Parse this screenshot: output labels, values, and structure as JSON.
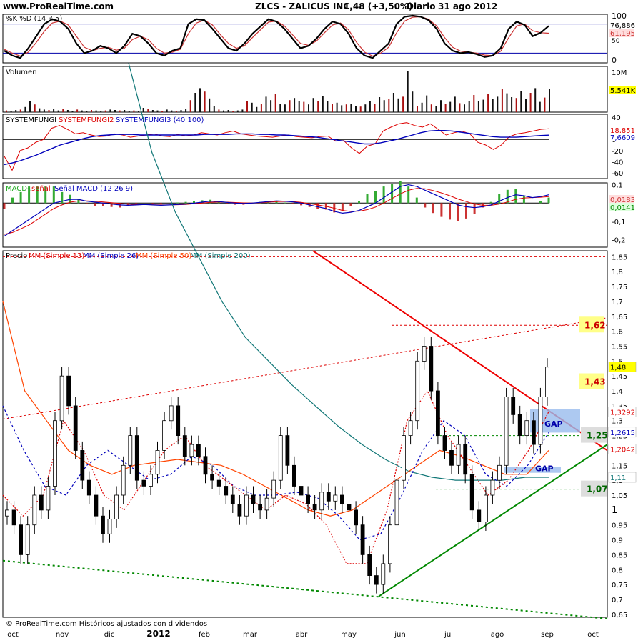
{
  "header": {
    "site": "www.ProRealTime.com",
    "title": "ZLCS - ZALICUS INC.",
    "quote": "1,48 (+3,50%)",
    "period": "Diario",
    "date": "31 ago 2012"
  },
  "footer": "© ProRealTime.com Históricos ajustados con dividendos",
  "x_labels": [
    "oct",
    "nov",
    "dic",
    "2012",
    "feb",
    "mar",
    "abr",
    "may",
    "jun",
    "jul",
    "ago",
    "sep",
    "oct"
  ],
  "colors": {
    "price_up": "#ffffff",
    "price_down": "#000000",
    "sma13": "#dd0000",
    "sma26": "#0000bb",
    "sma50": "#ff4400",
    "sma200": "#117777",
    "resistance": "#ee0000",
    "support": "#008800",
    "gap": "#99bbee"
  },
  "chart_data": [
    {
      "type": "line",
      "panel": "stochastic",
      "legend": "%K %D (14 3 5)",
      "ylim": [
        0,
        100
      ],
      "y_ticks": [
        "100",
        "50",
        "0"
      ],
      "levels": [
        80,
        20
      ],
      "last_values": {
        "%K": "76,886",
        "%D": "61,195"
      },
      "series": [
        {
          "name": "%K",
          "color": "#000000",
          "values": [
            25,
            15,
            10,
            30,
            55,
            80,
            90,
            85,
            70,
            40,
            20,
            25,
            35,
            30,
            20,
            35,
            60,
            55,
            40,
            20,
            15,
            25,
            30,
            80,
            90,
            88,
            70,
            50,
            30,
            25,
            40,
            60,
            75,
            90,
            85,
            70,
            50,
            30,
            35,
            50,
            70,
            85,
            80,
            60,
            30,
            15,
            10,
            25,
            40,
            80,
            95,
            97,
            95,
            88,
            70,
            40,
            25,
            20,
            22,
            18,
            12,
            15,
            30,
            70,
            85,
            78,
            55,
            62,
            76
          ]
        },
        {
          "name": "%D",
          "color": "#cc3333",
          "values": [
            28,
            20,
            14,
            22,
            42,
            65,
            82,
            86,
            78,
            55,
            32,
            25,
            30,
            32,
            26,
            30,
            48,
            55,
            48,
            30,
            20,
            22,
            28,
            60,
            82,
            88,
            78,
            58,
            40,
            30,
            35,
            52,
            68,
            84,
            86,
            76,
            58,
            40,
            36,
            45,
            62,
            78,
            82,
            68,
            42,
            22,
            14,
            20,
            32,
            62,
            86,
            94,
            95,
            90,
            76,
            52,
            32,
            24,
            22,
            20,
            16,
            15,
            24,
            52,
            76,
            80,
            66,
            62,
            61
          ]
        }
      ]
    },
    {
      "type": "bar",
      "panel": "volume",
      "legend": "Volumen",
      "y_ticks": [
        "10M"
      ],
      "last_value": "5.541K",
      "values": [
        0.4,
        0.3,
        0.5,
        0.6,
        1.2,
        2.5,
        1.8,
        0.9,
        0.6,
        0.5,
        0.7,
        0.4,
        0.8,
        0.5,
        0.3,
        0.6,
        0.4,
        0.3,
        0.5,
        0.4,
        0.3,
        0.4,
        0.6,
        0.5,
        0.4,
        0.5,
        0.3,
        0.4,
        0.3,
        1.0,
        0.8,
        0.5,
        0.4,
        0.3,
        0.6,
        0.4,
        0.3,
        0.5,
        0.7,
        2.8,
        4.5,
        5.6,
        4.8,
        3.2,
        1.5,
        0.6,
        0.4,
        0.5,
        0.3,
        0.4,
        0.6,
        2.6,
        2.2,
        1.2,
        2.0,
        3.6,
        2.8,
        4.2,
        2.0,
        1.8,
        2.8,
        3.3,
        2.6,
        2.4,
        1.8,
        3.3,
        2.5,
        3.8,
        2.6,
        1.9,
        2.2,
        1.6,
        1.8,
        2.0,
        1.5,
        1.3,
        1.8,
        2.6,
        1.9,
        3.5,
        2.8,
        3.0,
        4.5,
        3.2,
        3.6,
        9.5,
        4.8,
        1.5,
        2.2,
        3.9,
        1.8,
        1.4,
        2.8,
        1.9,
        2.4,
        3.6,
        2.1,
        1.8,
        2.5,
        4.0,
        2.6,
        2.9,
        4.2,
        3.1,
        3.6,
        5.5,
        4.4,
        3.5,
        3.3,
        5.0,
        3.0,
        4.5,
        5.6,
        2.4,
        3.4,
        5.5
      ]
    },
    {
      "type": "line",
      "panel": "systemfungi",
      "legend": [
        "SYSTEMFUNGI",
        "SYSTEMFUNGI2",
        "SYSTEMFUNGI3 (40 100)"
      ],
      "ylim": [
        -70,
        45
      ],
      "y_ticks": [
        40,
        20,
        0,
        -20,
        -40,
        -60
      ],
      "last_values": {
        "SYSTEMFUNGI2": "18,851",
        "SYSTEMFUNGI3": "7,6609"
      },
      "series": [
        {
          "name": "SYSTEMFUNGI2",
          "color": "#dd0000",
          "values": [
            -30,
            -55,
            -20,
            -15,
            -5,
            0,
            20,
            25,
            18,
            10,
            12,
            8,
            5,
            6,
            10,
            8,
            4,
            6,
            8,
            10,
            6,
            5,
            9,
            6,
            8,
            12,
            10,
            8,
            12,
            15,
            10,
            8,
            6,
            5,
            4,
            6,
            8,
            5,
            4,
            3,
            5,
            6,
            -3,
            -2,
            -15,
            -25,
            -12,
            -8,
            15,
            22,
            28,
            30,
            25,
            22,
            28,
            18,
            8,
            12,
            15,
            10,
            -5,
            -10,
            -18,
            -10,
            5,
            10,
            12,
            15,
            18,
            19
          ]
        },
        {
          "name": "SYSTEMFUNGI3",
          "color": "#0000bb",
          "values": [
            -45,
            -42,
            -38,
            -33,
            -28,
            -22,
            -16,
            -10,
            -6,
            -2,
            2,
            5,
            7,
            8,
            9,
            9,
            9,
            8,
            8,
            8,
            8,
            8,
            8,
            8,
            8,
            9,
            9,
            9,
            9,
            10,
            10,
            10,
            9,
            9,
            8,
            8,
            7,
            6,
            5,
            4,
            2,
            0,
            -2,
            -4,
            -6,
            -8,
            -8,
            -6,
            -3,
            0,
            4,
            8,
            12,
            15,
            16,
            16,
            15,
            13,
            11,
            9,
            7,
            5,
            4,
            4,
            4,
            5,
            6,
            7,
            7.7
          ]
        },
        {
          "name": "zero",
          "color": "#000000",
          "values": [
            0,
            0
          ]
        }
      ]
    },
    {
      "type": "area",
      "panel": "macd",
      "legend": [
        "MACD-,",
        "señal",
        "Señal MACD (12 26 9)"
      ],
      "ylim": [
        -0.24,
        0.11
      ],
      "y_ticks": [
        "0,1",
        "0",
        "-0,1",
        "-0,2"
      ],
      "last_values": {
        "MACD": "0,0183",
        "señal": "0,0141"
      },
      "series": [
        {
          "name": "MACD",
          "color": "#0000bb",
          "values": [
            -0.18,
            -0.15,
            -0.12,
            -0.09,
            -0.06,
            -0.03,
            0.0,
            0.01,
            0.02,
            0.02,
            0.01,
            0.005,
            0.0,
            -0.005,
            -0.01,
            -0.012,
            -0.01,
            -0.008,
            -0.01,
            -0.012,
            -0.01,
            -0.008,
            -0.006,
            0.0,
            0.005,
            0.01,
            0.008,
            0.004,
            0.0,
            -0.002,
            0.0,
            0.004,
            0.008,
            0.012,
            0.01,
            0.006,
            0.0,
            -0.01,
            -0.02,
            -0.03,
            -0.045,
            -0.055,
            -0.05,
            -0.04,
            -0.02,
            0.0,
            0.03,
            0.06,
            0.09,
            0.1,
            0.09,
            0.07,
            0.05,
            0.03,
            0.01,
            -0.01,
            -0.02,
            -0.025,
            -0.02,
            -0.01,
            0.01,
            0.03,
            0.045,
            0.04,
            0.03,
            0.035,
            0.045
          ]
        },
        {
          "name": "señal",
          "color": "#dd0000",
          "values": [
            -0.17,
            -0.16,
            -0.14,
            -0.12,
            -0.09,
            -0.06,
            -0.03,
            -0.01,
            0.005,
            0.012,
            0.012,
            0.01,
            0.006,
            0.002,
            -0.002,
            -0.006,
            -0.008,
            -0.008,
            -0.009,
            -0.01,
            -0.01,
            -0.009,
            -0.008,
            -0.004,
            0.0,
            0.004,
            0.006,
            0.005,
            0.003,
            0.001,
            0.0,
            0.002,
            0.005,
            0.008,
            0.009,
            0.008,
            0.004,
            -0.003,
            -0.01,
            -0.018,
            -0.028,
            -0.04,
            -0.045,
            -0.044,
            -0.036,
            -0.022,
            0.0,
            0.025,
            0.05,
            0.07,
            0.08,
            0.078,
            0.068,
            0.055,
            0.04,
            0.022,
            0.008,
            -0.005,
            -0.012,
            -0.012,
            -0.006,
            0.006,
            0.02,
            0.028,
            0.03,
            0.032,
            0.035
          ]
        }
      ]
    },
    {
      "type": "line",
      "panel": "price",
      "legend": [
        "Precio",
        "MM (Simple 13)",
        "MM (Simple 26)",
        "MM (Simple 50)",
        "MM (Simple 200)"
      ],
      "ylim": [
        0.64,
        1.87
      ],
      "y_ticks": [
        "1,85",
        "1,8",
        "1,75",
        "1,7",
        "1,65",
        "1,6",
        "1,55",
        "1,5",
        "1,45",
        "1,4",
        "1,35",
        "1,3",
        "1,25",
        "1,2",
        "1,15",
        "1,1",
        "1,05",
        "1",
        "0,95",
        "0,9",
        "0,85",
        "0,8",
        "0,75",
        "0,7",
        "0,65"
      ],
      "last_values": {
        "precio": "1,48",
        "SMA13": "1,3292",
        "SMA26": "1,2615",
        "SMA50": "1,2042",
        "SMA200": "1,11"
      },
      "levels": [
        {
          "label": "1,62",
          "value": 1.62
        },
        {
          "label": "1,43",
          "value": 1.43
        },
        {
          "label": "1,25",
          "value": 1.25
        },
        {
          "label": "1,07",
          "value": 1.07
        }
      ],
      "gaps": [
        "GAP",
        "GAP"
      ],
      "close": [
        1.0,
        0.95,
        0.85,
        0.95,
        1.05,
        1.0,
        1.08,
        1.3,
        1.45,
        1.35,
        1.2,
        1.1,
        1.05,
        0.98,
        0.92,
        0.97,
        1.05,
        1.15,
        1.25,
        1.1,
        1.08,
        1.12,
        1.2,
        1.3,
        1.35,
        1.25,
        1.18,
        1.22,
        1.18,
        1.12,
        1.1,
        1.08,
        1.05,
        1.02,
        0.98,
        1.05,
        1.02,
        1.0,
        1.04,
        1.1,
        1.25,
        1.15,
        1.08,
        1.05,
        1.02,
        1.0,
        1.06,
        1.03,
        1.05,
        1.02,
        1.0,
        0.95,
        0.85,
        0.78,
        0.75,
        0.82,
        0.95,
        1.1,
        1.25,
        1.3,
        1.5,
        1.55,
        1.4,
        1.25,
        1.2,
        1.15,
        1.22,
        1.12,
        1.0,
        0.96,
        1.05,
        1.1,
        1.15,
        1.38,
        1.32,
        1.25,
        1.3,
        1.22,
        1.38,
        1.48
      ]
    }
  ]
}
